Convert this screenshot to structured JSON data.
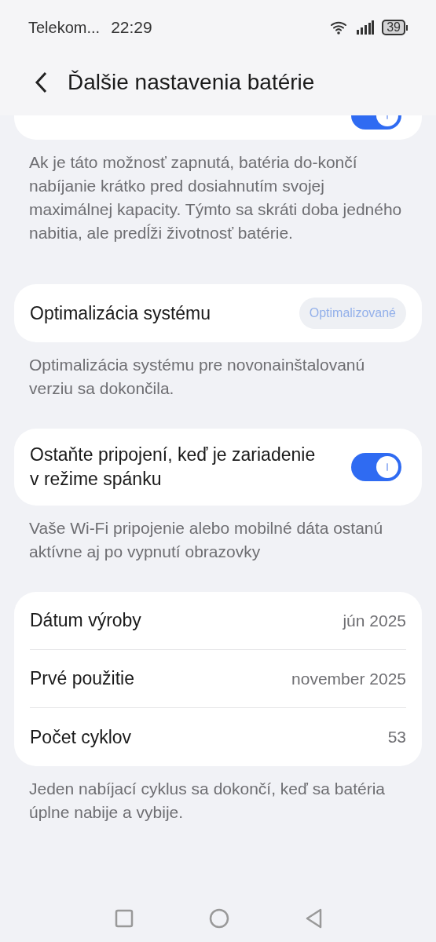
{
  "status_bar": {
    "carrier": "Telekom...",
    "time": "22:29",
    "battery": "39"
  },
  "header": {
    "title": "Ďalšie nastavenia batérie"
  },
  "top_card": {
    "toggle_on": true
  },
  "sections": [
    {
      "kind": "note",
      "text": "Ak je táto možnosť zapnutá, batéria do-končí nabíjanie krátko pred dosiahnutím svojej maximálnej kapacity. Týmto sa skráti doba jedného nabitia, ale predĺži životnosť batérie."
    },
    {
      "kind": "badge_row",
      "label": "Optimalizácia systému",
      "badge": "Optimalizované"
    },
    {
      "kind": "note",
      "text": "Optimalizácia systému pre novonainštalovanú verziu sa dokončila."
    },
    {
      "kind": "toggle_row",
      "label": "Ostaňte pripojení, keď je zariadenie v režime spánku",
      "on": true
    },
    {
      "kind": "note",
      "text": "Vaše Wi-Fi pripojenie alebo mobilné dáta ostanú aktívne aj po vypnutí obrazovky"
    },
    {
      "kind": "info_list",
      "rows": [
        {
          "label": "Dátum výroby",
          "value": "jún 2025"
        },
        {
          "label": "Prvé použitie",
          "value": "november 2025"
        },
        {
          "label": "Počet cyklov",
          "value": "53"
        }
      ]
    },
    {
      "kind": "note",
      "text": "Jeden nabíjací cyklus sa dokončí, keď sa batéria úplne nabije a vybije."
    }
  ]
}
